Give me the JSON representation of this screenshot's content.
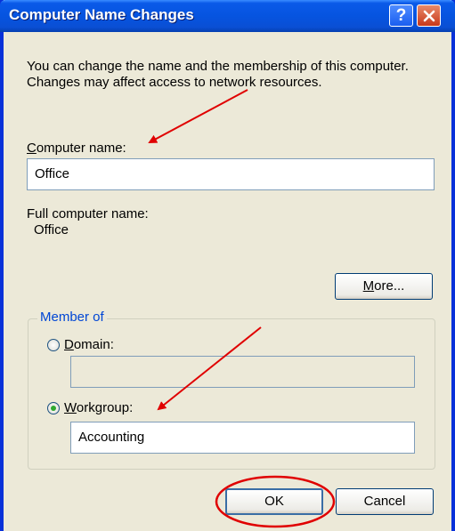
{
  "window": {
    "title": "Computer Name Changes",
    "help_glyph": "?",
    "close_icon": "close-icon"
  },
  "description": "You can change the name and the membership of this computer. Changes may affect access to network resources.",
  "computer_name": {
    "label_mnemonic": "C",
    "label_rest": "omputer name:",
    "value": "Office"
  },
  "full_name": {
    "label": "Full computer name:",
    "value": "Office"
  },
  "more_button": {
    "mnemonic": "M",
    "rest": "ore..."
  },
  "member_of": {
    "legend": "Member of",
    "domain": {
      "mnemonic": "D",
      "rest": "omain:",
      "selected": false,
      "value": ""
    },
    "workgroup": {
      "mnemonic": "W",
      "rest": "orkgroup:",
      "selected": true,
      "value": "Accounting"
    }
  },
  "buttons": {
    "ok": "OK",
    "cancel": "Cancel"
  },
  "annotations": {
    "color": "#e00000"
  }
}
